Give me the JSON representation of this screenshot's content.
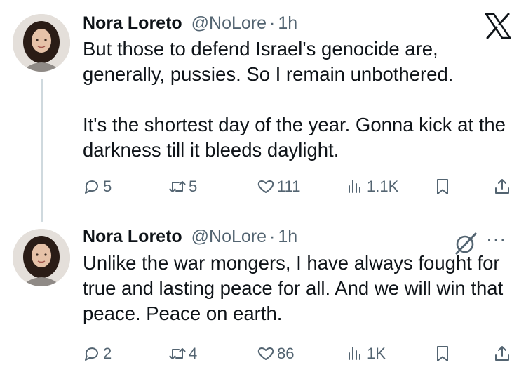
{
  "tweets": [
    {
      "author": {
        "name": "Nora Loreto",
        "handle": "@NoLore"
      },
      "separator": "·",
      "time": "1h",
      "text": "But those to defend Israel's genocide are, generally, pussies. So I remain unbothered.\n\nIt's the shortest day of the year. Gonna kick at the darkness till it bleeds daylight.",
      "stats": {
        "replies": "5",
        "reposts": "5",
        "likes": "111",
        "views": "1.1K"
      },
      "corner_icon": "x-logo-icon"
    },
    {
      "author": {
        "name": "Nora Loreto",
        "handle": "@NoLore"
      },
      "separator": "·",
      "time": "1h",
      "text": "Unlike the war mongers, I have always fought for true and lasting peace for all. And we will win that peace. Peace on earth.",
      "stats": {
        "replies": "2",
        "reposts": "4",
        "likes": "86",
        "views": "1K"
      },
      "corner_icon": "grok-icon"
    }
  ],
  "colors": {
    "text": "#0f1419",
    "muted": "#536471",
    "thread_line": "#cfd9de"
  }
}
